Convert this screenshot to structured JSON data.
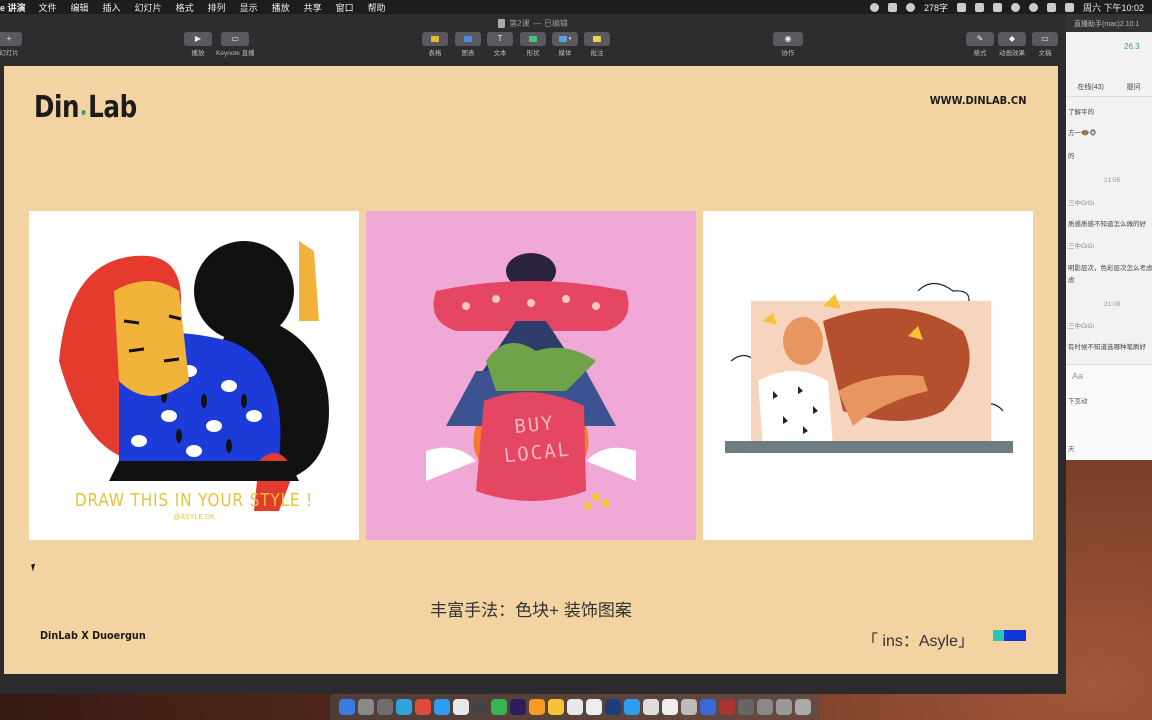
{
  "menubar": {
    "app_name": "e 讲演",
    "items": [
      "文件",
      "编辑",
      "插入",
      "幻灯片",
      "格式",
      "排列",
      "显示",
      "播放",
      "共享",
      "窗口",
      "帮助"
    ],
    "word_count": "278字",
    "clock": "周六 下午10:02"
  },
  "window": {
    "title": "第2课",
    "title_status": "— 已编辑"
  },
  "toolbar": {
    "add_slide": "幻灯片",
    "play": "播放",
    "keynote_live": "Keynote 直播",
    "table": "表格",
    "chart": "图表",
    "text": "文本",
    "shape": "形状",
    "media": "媒体",
    "comment": "批注",
    "collaborate": "协作",
    "format": "格式",
    "animate": "动画效果",
    "document": "文稿"
  },
  "slide": {
    "logo_left": "Din",
    "logo_right": "Lab",
    "website": "WWW.DINLAB.CN",
    "caption": "丰富手法：色块+ 装饰图案",
    "footer_left": "DinLab X Duoergun",
    "footer_right": "「 ins：Asyle」",
    "images": [
      {
        "title": "DRAW THIS IN YOUR STYLE !",
        "subtitle": "@ASYLE.DK",
        "background": "#ffffff"
      },
      {
        "title": "BUY LOCAL",
        "background": "#f0a8d6"
      },
      {
        "background": "#ffffff"
      }
    ],
    "accent_colors": [
      "#2ec4b6",
      "#1034d8"
    ]
  },
  "chat": {
    "title": "直播助手(mac)2.10.1",
    "signal": "26.3",
    "tabs": [
      "在线(43)",
      "提问"
    ],
    "messages": [
      {
        "text": "了解平的"
      },
      {
        "text": "方一🍩🐵"
      },
      {
        "text": "的"
      },
      {
        "text": "21:05",
        "type": "time"
      },
      {
        "text": "三中GiGi",
        "type": "name"
      },
      {
        "text": "质感质感不知道怎么做的好"
      },
      {
        "text": "三中GiGi",
        "type": "name"
      },
      {
        "text": "明影层次，色彩层次怎么考虑"
      },
      {
        "text": "虑"
      },
      {
        "text": "21:08",
        "type": "time"
      },
      {
        "text": "三中GiGi",
        "type": "name"
      },
      {
        "text": "有时候不知道选哪种笔刷好"
      }
    ],
    "input_font_label": "Aa",
    "interact_label": "下互动",
    "sky_label": "天"
  }
}
